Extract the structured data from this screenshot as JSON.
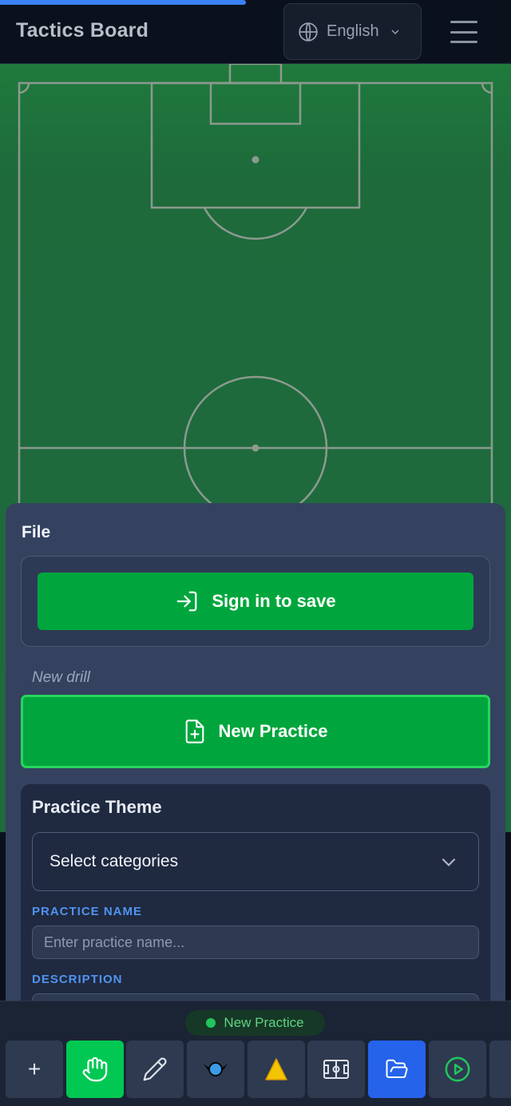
{
  "header": {
    "app_title": "Tactics Board",
    "language_label": "English",
    "accent_color": "#3b82f6"
  },
  "file_panel": {
    "title": "File",
    "sign_in_label": "Sign in to save",
    "drill_status": "New drill",
    "new_practice_label": "New Practice",
    "primary_color": "#00a63d"
  },
  "practice_theme": {
    "title": "Practice Theme",
    "select_value": "Select categories",
    "practice_name_label": "PRACTICE NAME",
    "practice_name_placeholder": "Enter practice name...",
    "description_label": "DESCRIPTION"
  },
  "bottom_bar": {
    "status_label": "New Practice",
    "tools": [
      {
        "icon": "plus-icon",
        "label": "+",
        "state": "default"
      },
      {
        "icon": "hand-icon",
        "state": "active"
      },
      {
        "icon": "pencil-icon",
        "state": "default"
      },
      {
        "icon": "player-icon",
        "state": "default"
      },
      {
        "icon": "cone-icon",
        "state": "default"
      },
      {
        "icon": "field-icon",
        "state": "default"
      },
      {
        "icon": "folder-icon",
        "state": "selected"
      },
      {
        "icon": "play-icon",
        "state": "default"
      },
      {
        "icon": "more-icon",
        "state": "default"
      }
    ]
  }
}
